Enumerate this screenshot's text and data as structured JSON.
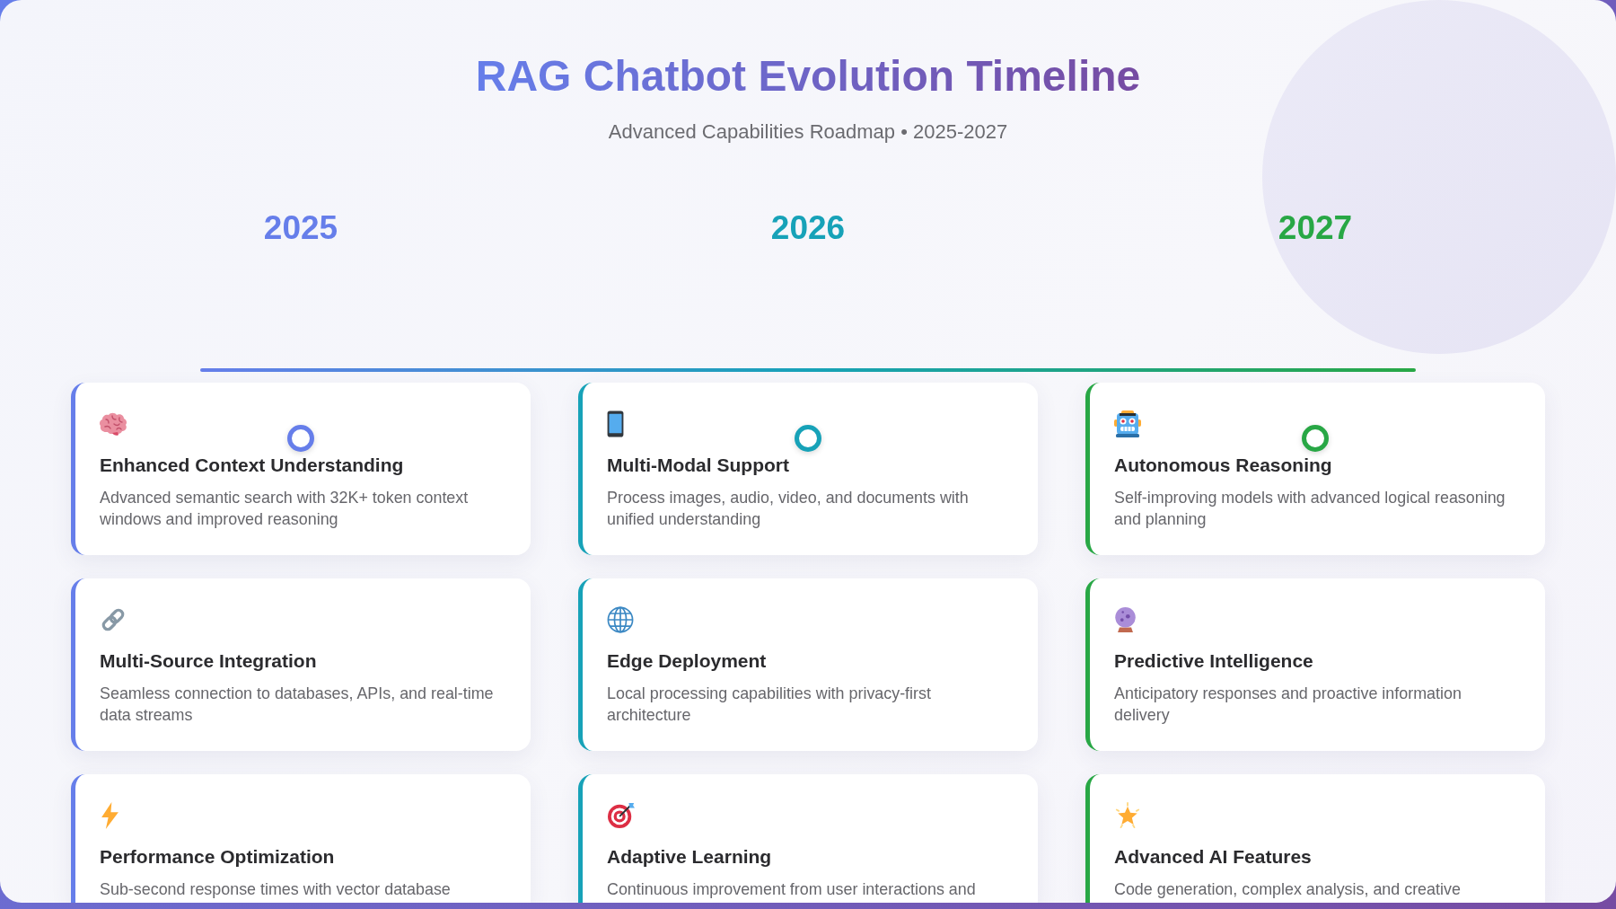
{
  "header": {
    "title": "RAG Chatbot Evolution Timeline",
    "subtitle": "Advanced Capabilities Roadmap • 2025-2027"
  },
  "timeline": {
    "phases": [
      {
        "year": "2025",
        "color": "#667eea",
        "features": [
          {
            "title": "Enhanced Context Understanding",
            "description": "Advanced semantic search with 32K+ token context windows and improved reasoning"
          },
          {
            "title": "Multi-Source Integration",
            "description": "Seamless connection to databases, APIs, and real-time data streams"
          },
          {
            "title": "Performance Optimization",
            "description": "Sub-second response times with vector database"
          }
        ]
      },
      {
        "year": "2026",
        "color": "#17a2b8",
        "features": [
          {
            "title": "Multi-Modal Support",
            "description": "Process images, audio, video, and documents with unified understanding"
          },
          {
            "title": "Edge Deployment",
            "description": "Local processing capabilities with privacy-first architecture"
          },
          {
            "title": "Adaptive Learning",
            "description": "Continuous improvement from user interactions and"
          }
        ]
      },
      {
        "year": "2027",
        "color": "#28a745",
        "features": [
          {
            "title": "Autonomous Reasoning",
            "description": "Self-improving models with advanced logical reasoning and planning"
          },
          {
            "title": "Predictive Intelligence",
            "description": "Anticipatory responses and proactive information delivery"
          },
          {
            "title": "Advanced AI Features",
            "description": "Code generation, complex analysis, and creative"
          }
        ]
      }
    ]
  }
}
